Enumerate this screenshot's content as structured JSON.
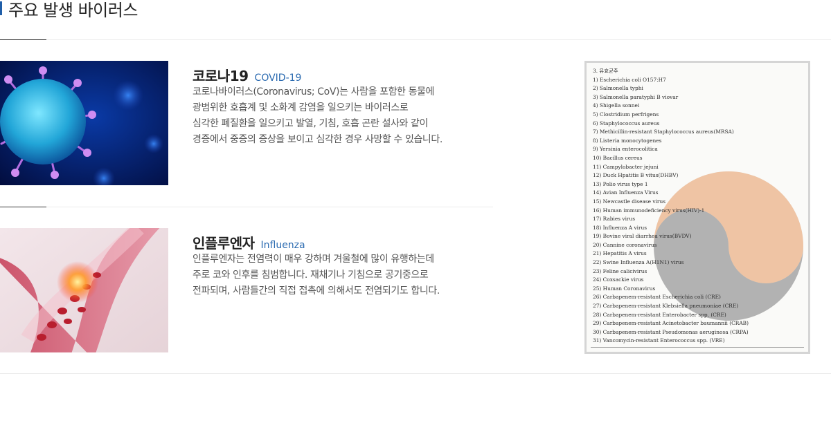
{
  "page": {
    "title": "주요 발생 바이러스"
  },
  "colors": {
    "accent": "#1f5ea8",
    "link_blue": "#2a6ab0",
    "text": "#555555"
  },
  "entries": [
    {
      "name": "코로나19",
      "english": "COVID-19",
      "lines": [
        "코로나바이러스(Coronavirus; CoV)는 사람을 포함한 동물에",
        "광범위한 호흡계 및 소화계 감염을 일으키는 바이러스로",
        "심각한 폐질환을 일으키고 발열, 기침, 호흡 곤란 설사와 같이",
        "경증에서 중증의 증상을 보이고 심각한 경우 사망할 수 있습니다."
      ]
    },
    {
      "name": "인플루엔자",
      "english": "Influenza",
      "lines": [
        "인플루엔자는 전염력이 매우 강하며 겨울철에 많이 유행하는데",
        "주로 코와 인후를 침범합니다. 재채기나 기침으로 공기중으로",
        "전파되며, 사람들간의 직접 접촉에 의해서도 전염되기도 합니다."
      ]
    }
  ],
  "document": {
    "heading": "3. 유효균주",
    "items": [
      "1) Escherichia coli O157:H7",
      "2) Salmonella typhi",
      "3) Salmonella paratyphi B viovar",
      "4) Shigella sonnei",
      "5) Clostridium perfrigens",
      "6) Staphylococcus aureus",
      "7) Methicillin-resistant Staphylococcus aureus(MRSA)",
      "8) Listeria monocytogenes",
      "9) Yersinia enterocolitica",
      "10) Bacillus cereus",
      "11) Campylobacter jejuni",
      "12) Duck Hpatitis B vitus(DHBV)",
      "13) Polio virus type 1",
      "14) Avian Influenza Virus",
      "15) Newcastle disease virus",
      "16) Human immunodeficiency virus(HIV)-1",
      "17) Rabies virus",
      "18) Influenza A virus",
      "19) Bovine viral diarrhea virus(BVDV)",
      "20) Cannine coronavirus",
      "21) Hepatitis A virus",
      "22) Swine Influenza A(H1N1) virus",
      "23) Feline calicivirus",
      "24) Coxsackie virus",
      "25) Human Coronavirus",
      "26) Carbapenem-resistant Escherichia coli (CRE)",
      "27) Carbapenem-resistant Klebsiella pneumoniae (CRE)",
      "28) Carbapenem-resistant Enterobacter spp. (CRE)",
      "29) Carbapenem-resistant Acinetobacter baumannii (CRAB)",
      "30) Carbapenem-resistant Pseudomonas aeruginosa (CRPA)",
      "31) Vancomycin-resistant Enterococcus spp. (VRE)"
    ]
  }
}
